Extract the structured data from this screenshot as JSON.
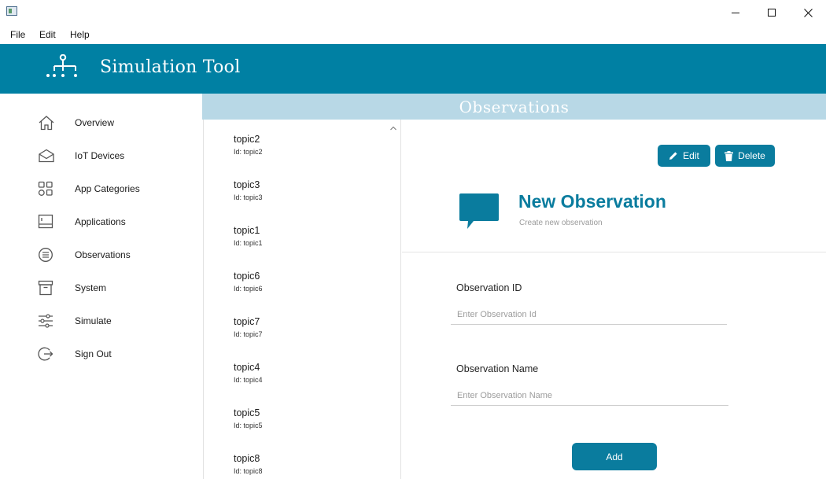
{
  "window": {
    "controls": {
      "minimize_icon": "minimize-icon",
      "maximize_icon": "maximize-icon",
      "close_icon": "close-icon"
    }
  },
  "menu": [
    "File",
    "Edit",
    "Help"
  ],
  "header": {
    "title": "Simulation Tool",
    "logo_icon": "network-tree-icon",
    "color": "#0080a3"
  },
  "sidebar": {
    "items": [
      {
        "label": "Overview",
        "icon": "home-icon"
      },
      {
        "label": "IoT Devices",
        "icon": "envelope-icon"
      },
      {
        "label": "App Categories",
        "icon": "grid-icon"
      },
      {
        "label": "Applications",
        "icon": "window-icon"
      },
      {
        "label": "Observations",
        "icon": "list-circle-icon"
      },
      {
        "label": "System",
        "icon": "archive-icon"
      },
      {
        "label": "Simulate",
        "icon": "sliders-icon"
      },
      {
        "label": "Sign Out",
        "icon": "sign-out-icon"
      }
    ]
  },
  "banner": {
    "title": "Observations",
    "color": "#b8d8e6"
  },
  "topics": [
    {
      "name": "topic2",
      "id": "Id: topic2"
    },
    {
      "name": "topic3",
      "id": "Id: topic3"
    },
    {
      "name": "topic1",
      "id": "Id: topic1"
    },
    {
      "name": "topic6",
      "id": "Id: topic6"
    },
    {
      "name": "topic7",
      "id": "Id: topic7"
    },
    {
      "name": "topic4",
      "id": "Id: topic4"
    },
    {
      "name": "topic5",
      "id": "Id: topic5"
    },
    {
      "name": "topic8",
      "id": "Id: topic8"
    }
  ],
  "detail": {
    "edit_label": "Edit",
    "delete_label": "Delete",
    "title": "New Observation",
    "subtitle": "Create new observation",
    "id_label": "Observation ID",
    "id_placeholder": "Enter Observation Id",
    "name_label": "Observation Name",
    "name_placeholder": "Enter Observation Name",
    "add_label": "Add",
    "accent": "#0a7c9e"
  }
}
